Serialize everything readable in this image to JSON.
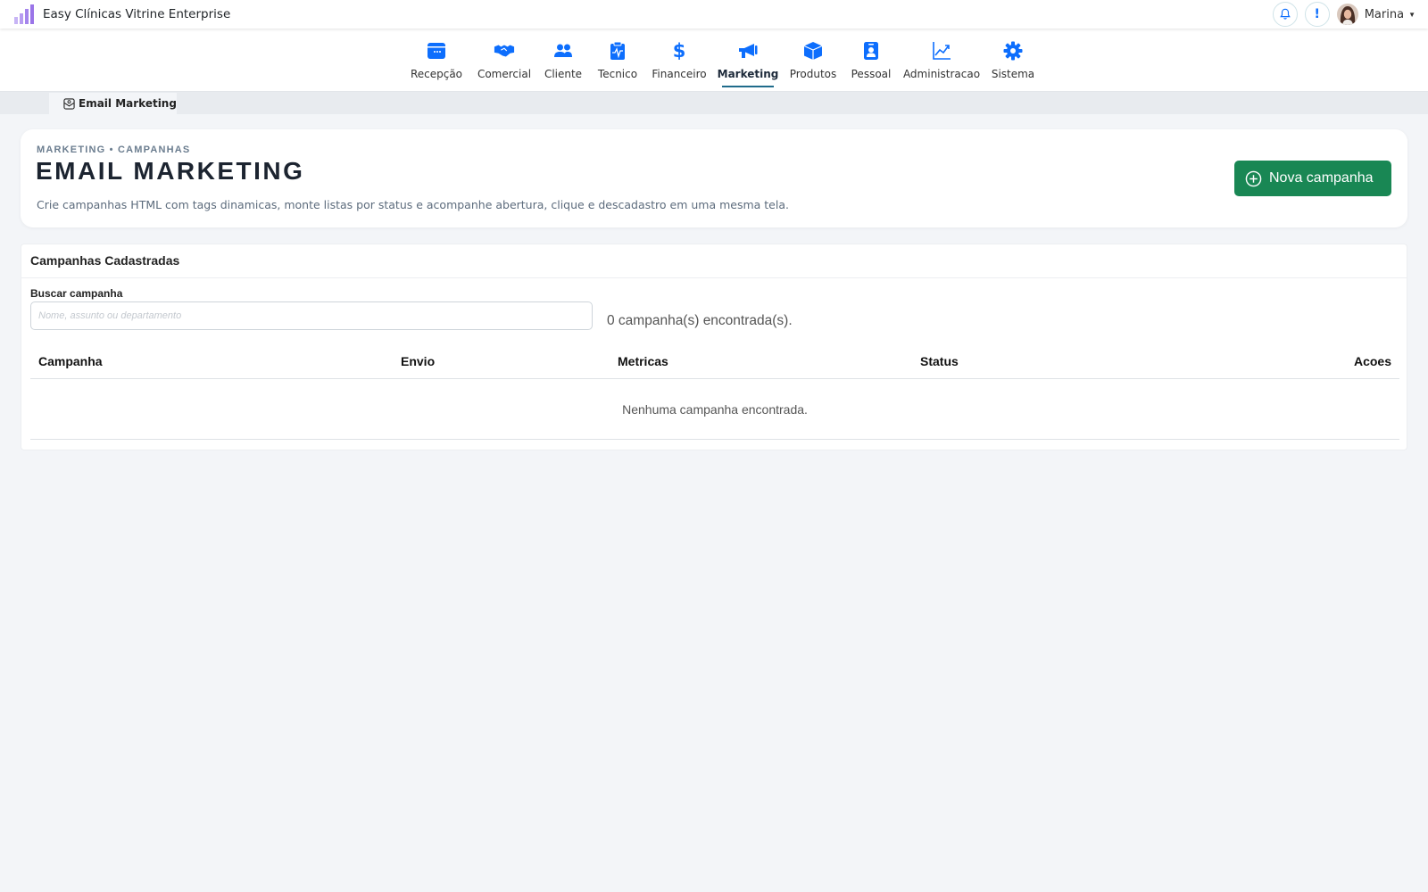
{
  "app": {
    "title": "Easy Clínicas Vitrine Enterprise"
  },
  "user": {
    "name": "Marina"
  },
  "icons": {
    "logo": "bar-chart-logo-icon",
    "notifications": "bell-icon",
    "alerts": "exclamation-icon",
    "user_menu": "caret-down-icon"
  },
  "nav": {
    "items": [
      {
        "label": "Recepção",
        "icon": "window-icon",
        "active": false
      },
      {
        "label": "Comercial",
        "icon": "handshake-icon",
        "active": false
      },
      {
        "label": "Cliente",
        "icon": "people-icon",
        "active": false
      },
      {
        "label": "Tecnico",
        "icon": "clipboard-pulse-icon",
        "active": false
      },
      {
        "label": "Financeiro",
        "icon": "dollar-icon",
        "active": false
      },
      {
        "label": "Marketing",
        "icon": "megaphone-icon",
        "active": true
      },
      {
        "label": "Produtos",
        "icon": "box-icon",
        "active": false
      },
      {
        "label": "Pessoal",
        "icon": "person-badge-icon",
        "active": false
      },
      {
        "label": "Administracao",
        "icon": "graph-up-icon",
        "active": false
      },
      {
        "label": "Sistema",
        "icon": "gear-icon",
        "active": false
      }
    ]
  },
  "tab": {
    "label": "Email Marketing",
    "icon": "envelope-open-icon"
  },
  "header": {
    "eyebrow": "MARKETING • CAMPANHAS",
    "title": "EMAIL MARKETING",
    "description": "Crie campanhas HTML com tags dinamicas, monte listas por status e acompanhe abertura, clique e descadastro em uma mesma tela.",
    "new_button": "Nova campanha"
  },
  "campaigns": {
    "title": "Campanhas Cadastradas",
    "search_label": "Buscar campanha",
    "search_placeholder": "Nome, assunto ou departamento",
    "search_value": "",
    "count_text": "0 campanha(s) encontrada(s).",
    "columns": [
      "Campanha",
      "Envio",
      "Metricas",
      "Status",
      "Acoes"
    ],
    "empty_text": "Nenhuma campanha encontrada."
  },
  "colors": {
    "primary": "#0d6efd",
    "success": "#198754",
    "active_underline": "#1f6b8b",
    "logo_purple": "#a07be8"
  }
}
